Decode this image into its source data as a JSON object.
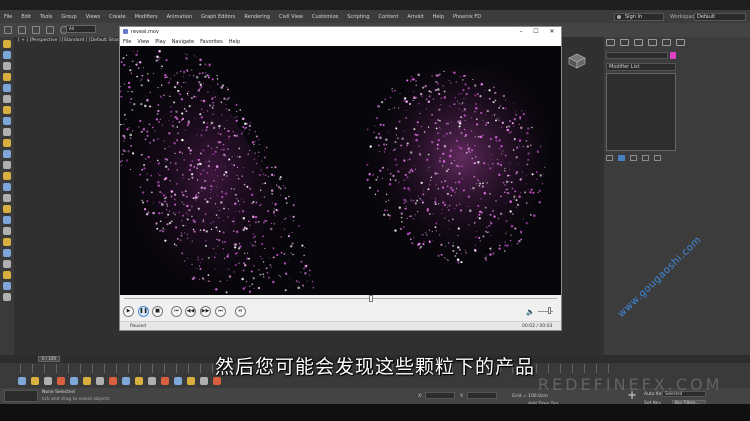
{
  "app_menu": [
    "File",
    "Edit",
    "Tools",
    "Group",
    "Views",
    "Create",
    "Modifiers",
    "Animation",
    "Graph Editors",
    "Rendering",
    "Civil View",
    "Customize",
    "Scripting",
    "Content",
    "Arnold",
    "Help",
    "Phoenix FD"
  ],
  "account": {
    "sign_in": "Sign In",
    "workspaces_label": "Workspaces:",
    "workspace": "Default"
  },
  "toolbar": {
    "selection_filter": "All"
  },
  "viewport": {
    "label": "[ + ] [Perspective ] [Standard ] [Default Shad"
  },
  "command_panel": {
    "modifier_list": "Modifier List"
  },
  "player": {
    "title": "reveal.mov",
    "menu": [
      "File",
      "View",
      "Play",
      "Navigate",
      "Favorites",
      "Help"
    ],
    "status": "Paused",
    "time": "00:02 / 00:03",
    "progress": 0.57,
    "volume": 0.7
  },
  "timeline": {
    "frame": "0 / 100"
  },
  "statusbar": {
    "selection": "None Selected",
    "hint": "lick and drag to select objects",
    "x_label": "X:",
    "y_label": "Y:",
    "grid": "Grid = 100.0cm",
    "time_tag": "Add Time Tag",
    "auto_key": "Auto Key",
    "selected": "Selected",
    "set_key": "Set Key",
    "key_filters": "Key Filters..."
  },
  "subtitle": "然后您可能会发现这些颗粒下的产品",
  "watermark": {
    "url": "www.gougaoshi.com",
    "brand": "REDEFINEFX.COM"
  },
  "colors": {
    "particle": "#e070e8",
    "particle_bright": "#ffffff",
    "accent": "#3d8fe8"
  }
}
